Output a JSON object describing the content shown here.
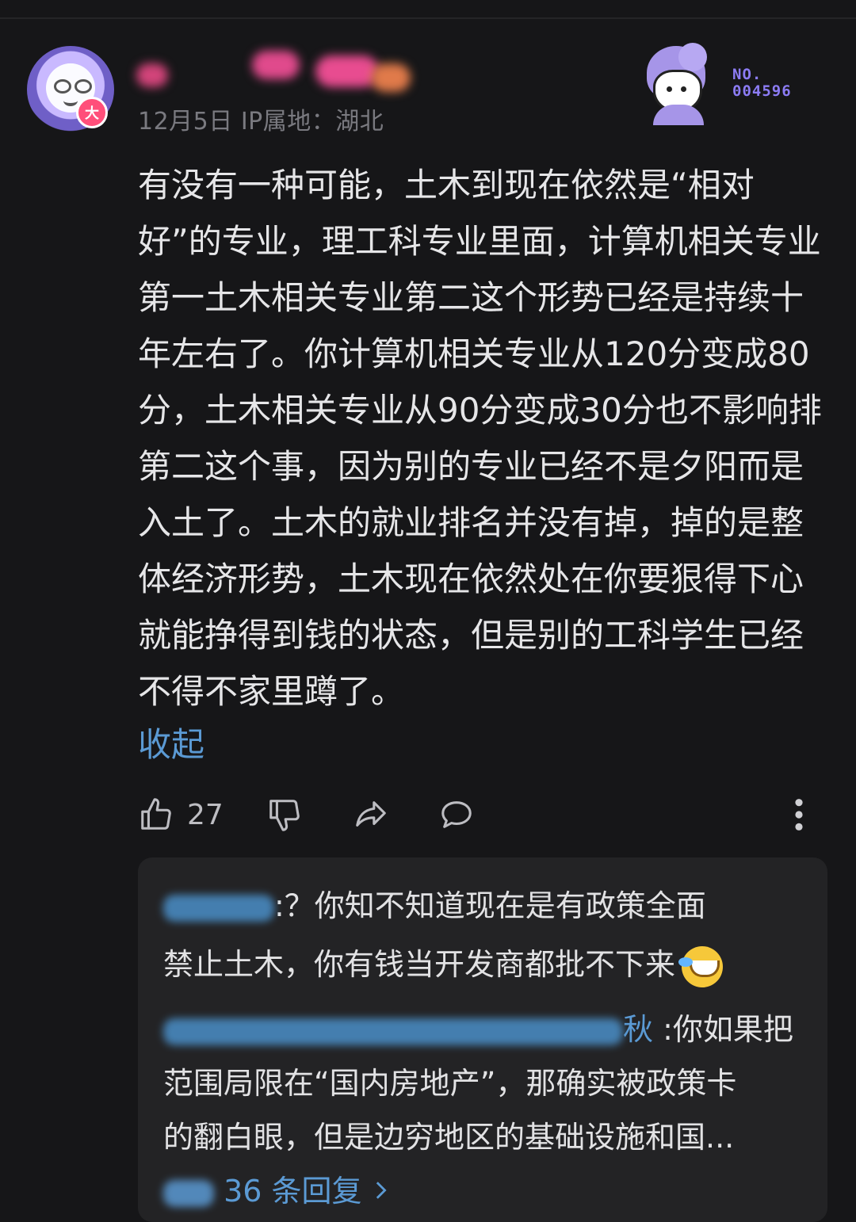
{
  "comment": {
    "date": "12月5日",
    "ip_location": "IP属地：湖北",
    "avatar_badge": "大",
    "decoration_number": "NO.\n004596",
    "text": "有没有一种可能，土木到现在依然是“相对好”的专业，理工科专业里面，计算机相关专业第一土木相关专业第二这个形势已经是持续十年左右了。你计算机相关专业从120分变成80分，土木相关专业从90分变成30分也不影响排第二这个事，因为别的专业已经不是夕阳而是入土了。土木的就业排名并没有掉，掉的是整体经济形势，土木现在依然处在你要狠得下心就能挣得到钱的状态，但是别的工科学生已经不得不家里蹲了。",
    "collapse_label": "收起"
  },
  "actions": {
    "like_count": "27",
    "like_icon": "thumbs-up-icon",
    "dislike_icon": "thumbs-down-icon",
    "share_icon": "share-icon",
    "comment_icon": "comment-icon",
    "more_icon": "more-vertical-icon"
  },
  "replies": [
    {
      "text_line1": ":？你知不知道现在是有政策全面",
      "text_line2": "禁止土木，你有钱当开发商都批不下来",
      "emoji": "laughing-crying-emoji"
    },
    {
      "name_tail": "秋",
      "text_line1": " :你如果把",
      "text_line2": "范围局限在“国内房地产”，那确实被政策卡",
      "text_line3": "的翻白眼，但是边穷地区的基础设施和国..."
    }
  ],
  "view_replies": {
    "label": "36 条回复",
    "chevron_icon": "chevron-right-icon"
  },
  "colors": {
    "background": "#161618",
    "text": "#e6e6e8",
    "link": "#5b9ad4",
    "meta": "#7a7a80",
    "reply_box": "#232325",
    "badge": "#ff4f7a",
    "decor": "#8c7cf4"
  }
}
